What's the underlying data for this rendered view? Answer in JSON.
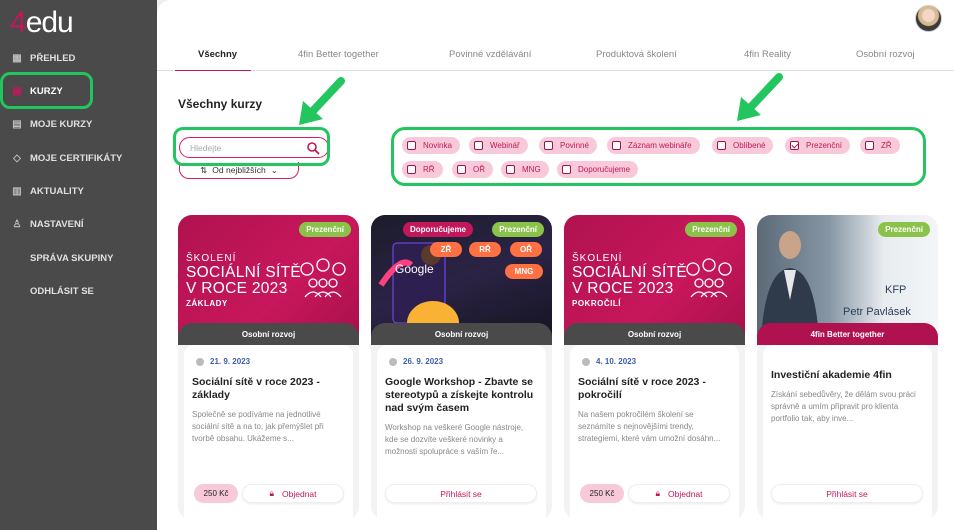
{
  "sidebar": {
    "logo_num": "4",
    "logo_text": "edu",
    "items": [
      {
        "label": "PŘEHLED",
        "icon": "grid-icon"
      },
      {
        "label": "KURZY",
        "icon": "box-icon"
      },
      {
        "label": "MOJE KURZY",
        "icon": "certificate-doc-icon"
      },
      {
        "label": "MOJE CERTIFIKÁTY",
        "icon": "graduation-cap-icon"
      },
      {
        "label": "AKTUALITY",
        "icon": "news-icon"
      },
      {
        "label": "NASTAVENÍ",
        "icon": "user-settings-icon"
      },
      {
        "label": "SPRÁVA SKUPINY"
      },
      {
        "label": "ODHLÁSIT SE"
      }
    ]
  },
  "tabs": [
    {
      "label": "Všechny"
    },
    {
      "label": "4fin Better together"
    },
    {
      "label": "Povinné vzdělávání"
    },
    {
      "label": "Produktová školení"
    },
    {
      "label": "4fin Reality"
    },
    {
      "label": "Osobní rozvoj"
    }
  ],
  "main": {
    "heading": "Všechny kurzy",
    "search_placeholder": "Hledejte",
    "sort_label": "Od nejbližších"
  },
  "filters": [
    {
      "label": "Novinka",
      "checked": false
    },
    {
      "label": "Webinář",
      "checked": false
    },
    {
      "label": "Povinné",
      "checked": false
    },
    {
      "label": "Záznam webináře",
      "checked": false
    },
    {
      "label": "Oblíbené",
      "checked": false
    },
    {
      "label": "Prezenční",
      "checked": true
    },
    {
      "label": "ZŘ",
      "checked": false
    },
    {
      "label": "RŘ",
      "checked": false
    },
    {
      "label": "OŘ",
      "checked": false
    },
    {
      "label": "MNG",
      "checked": false
    },
    {
      "label": "Doporučujeme",
      "checked": false
    }
  ],
  "cards": [
    {
      "badge": "Prezenční",
      "banner_kicker": "ŠKOLENÍ",
      "banner_title_1": "SOCIÁLNÍ SÍTĚ",
      "banner_title_2": "V ROCE 2023",
      "banner_sub": "ZÁKLADY",
      "category": "Osobní rozvoj",
      "date": "21. 9. 2023",
      "title": "Sociální sítě v roce 2023 - základy",
      "desc": "Společně se podíváme na jednotlivé sociální sítě a na to, jak přemýšlet při tvorbě obsahu. Ukážeme s...",
      "price": "250 Kč",
      "action": "Objednat"
    },
    {
      "badge_left": "Doporučujeme",
      "badge": "Prezenční",
      "tags": [
        "ZŘ",
        "RŘ",
        "OŘ",
        "MNG"
      ],
      "banner_word": "Google",
      "category": "Osobní rozvoj",
      "date": "26. 9. 2023",
      "title": "Google Workshop - Zbavte se stereotypů a získejte kontrolu nad svým časem",
      "desc": "Workshop na veškeré Google nástroje, kde se dozvíte veškeré novinky a možnosti spolupráce s vaším ře...",
      "action": "Přihlásit se"
    },
    {
      "badge": "Prezenční",
      "banner_kicker": "ŠKOLENÍ",
      "banner_title_1": "SOCIÁLNÍ SÍTĚ",
      "banner_title_2": "V ROCE 2023",
      "banner_sub": "POKROČILÍ",
      "category": "Osobní rozvoj",
      "date": "4. 10. 2023",
      "title": "Sociální sítě v roce 2023 - pokročilí",
      "desc": "Na našem pokročilém školení se seznámíte s nejnovějšími trendy, strategiemi, které vám umožní dosáhn...",
      "price": "250 Kč",
      "action": "Objednat"
    },
    {
      "badge": "Prezenční",
      "banner_kfp": "KFP",
      "banner_name": "Petr Pavlásek",
      "category": "4fin Better together",
      "title": "Investiční akademie 4fin",
      "desc": "Získání sebedůvěry, že dělám svou práci správně a umím připravit pro klienta portfolio tak, aby inve...",
      "action": "Přihlásit se"
    }
  ],
  "colors": {
    "brand": "#c2185b",
    "sidebar": "#4a4a4a",
    "highlight": "#22c55e",
    "badge_green": "#8bc34a"
  }
}
